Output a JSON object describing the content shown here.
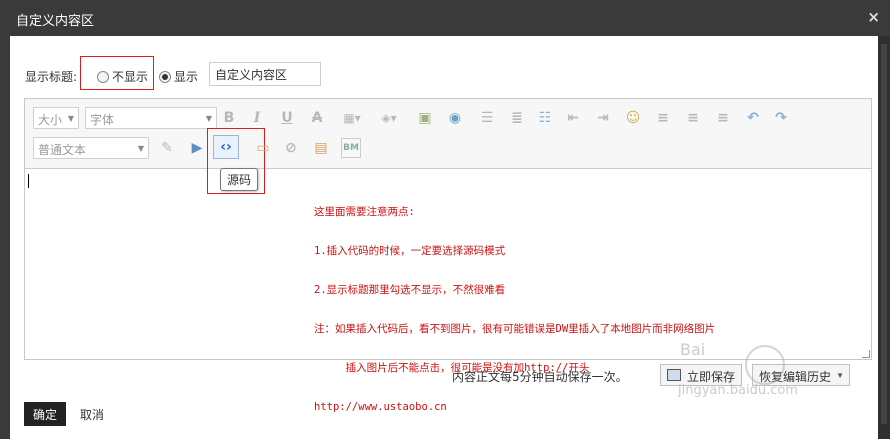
{
  "dialog": {
    "title": "自定义内容区",
    "close_glyph": "×"
  },
  "title_row": {
    "label": "显示标题:",
    "hide_label": "不显示",
    "show_label": "显示",
    "title_value": "自定义内容区",
    "selected": "show"
  },
  "toolbar": {
    "size_label": "大小",
    "font_label": "字体",
    "format_label": "普通文本",
    "tooltip": "源码",
    "icons": [
      "bold-icon",
      "italic-icon",
      "underline-icon",
      "strike-icon",
      "table-icon",
      "color-icon",
      "image-icon",
      "map-icon",
      "list-ol-icon",
      "list-ul-icon",
      "outdent-icon",
      "indent-icon",
      "emoticon-icon",
      "align-left-icon",
      "align-center-icon",
      "align-right-icon",
      "undo-icon",
      "redo-icon",
      "format-painter-icon",
      "media-icon",
      "source-icon",
      "flash-icon",
      "link-icon",
      "template-icon",
      "bm-icon"
    ]
  },
  "content": {
    "lines": [
      "这里面需要注意两点:",
      "1.插入代码的时候，一定要选择源码模式",
      "2.显示标题那里勾选不显示，不然很难看",
      "注：如果插入代码后，看不到图片，很有可能错误是DW里插入了本地图片而非网络图片",
      "     插入图片后不能点击，很可能是没有加http://开头",
      "http://www.ustaobo.cn"
    ]
  },
  "status": {
    "autosave": "内容正文每5分钟自动保存一次。",
    "save_now": "立即保存",
    "restore": "恢复编辑历史"
  },
  "footer": {
    "ok": "确定",
    "cancel": "取消"
  },
  "watermark": {
    "main": "Bai",
    "sub": "jingyan.baidu.com"
  },
  "colors": {
    "accent": "#d62020",
    "titlebar": "#3a3a3a",
    "note_text": "#cc1111"
  }
}
